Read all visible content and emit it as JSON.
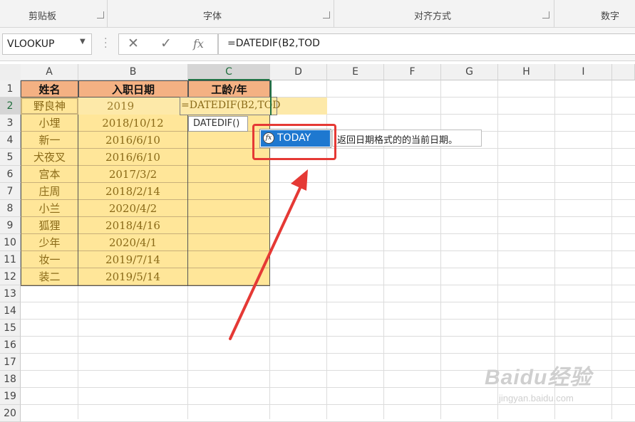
{
  "ribbon": {
    "groups": [
      "剪贴板",
      "字体",
      "对齐方式",
      "数字"
    ]
  },
  "formula_bar": {
    "name_box": "VLOOKUP",
    "cancel_symbol": "✕",
    "enter_symbol": "✓",
    "fx_symbol": "fx",
    "formula": "=DATEDIF(B2,TOD"
  },
  "columns": [
    "A",
    "B",
    "C",
    "D",
    "E",
    "F",
    "G",
    "H",
    "I"
  ],
  "rows": [
    "1",
    "2",
    "3",
    "4",
    "5",
    "6",
    "7",
    "8",
    "9",
    "10",
    "11",
    "12",
    "13",
    "14",
    "15",
    "16",
    "17",
    "18",
    "19",
    "20"
  ],
  "table": {
    "headers": [
      "姓名",
      "入职日期",
      "工龄/年"
    ],
    "rows": [
      {
        "name": "野良神",
        "date": "2019"
      },
      {
        "name": "小埋",
        "date": "2018/10/12"
      },
      {
        "name": "新一",
        "date": "2016/6/10"
      },
      {
        "name": "犬夜叉",
        "date": "2016/6/10"
      },
      {
        "name": "宫本",
        "date": "2017/3/2"
      },
      {
        "name": "庄周",
        "date": "2018/2/14"
      },
      {
        "name": "小兰",
        "date": "2020/4/2"
      },
      {
        "name": "狐狸",
        "date": "2018/4/16"
      },
      {
        "name": "少年",
        "date": "2020/4/1"
      },
      {
        "name": "妆一",
        "date": "2019/7/14"
      },
      {
        "name": "装二",
        "date": "2019/5/14"
      }
    ]
  },
  "editing": {
    "cell_text": "=DATEDIF(B2,TOD",
    "tooltip": "DATEDIF()"
  },
  "autocomplete": {
    "item": "TODAY",
    "icon": "fx",
    "description": "返回日期格式的的当前日期。"
  },
  "colors": {
    "header_fill": "#f4b183",
    "data_fill": "#ffe699",
    "highlight": "#1e78d0",
    "annotation": "#e53935"
  },
  "watermark": {
    "text": "Baidu经验",
    "sub": "jingyan.baidu.com"
  }
}
